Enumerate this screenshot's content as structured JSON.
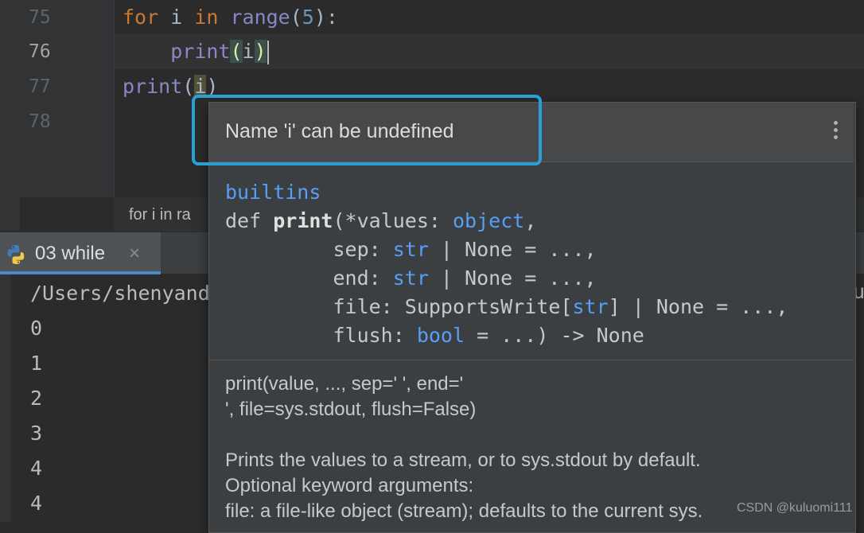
{
  "editor": {
    "line_numbers": [
      "75",
      "76",
      "77",
      "78"
    ],
    "lines": {
      "l75": {
        "kw_for": "for",
        "var": " i ",
        "kw_in": "in",
        "fn": " range",
        "open": "(",
        "num": "5",
        "close": "):"
      },
      "l76": {
        "indent": "    ",
        "fn": "print",
        "open": "(",
        "arg": "i",
        "close": ")"
      },
      "l77": {
        "fn": "print",
        "open": "(",
        "arg": "i",
        "close": ")"
      }
    },
    "breadcrumb": "for i in ra"
  },
  "run": {
    "tab_label": "03 while",
    "tab_close": "×",
    "output": [
      "/Users/shenyand",
      "0",
      "1",
      "2",
      "3",
      "4",
      "4"
    ],
    "edge_char": "u"
  },
  "popup": {
    "warning": "Name 'i' can be undefined",
    "module": "builtins",
    "signature": {
      "def": "def ",
      "name": "print",
      "l1_rest_a": "(*values: ",
      "l1_type": "object",
      "l1_rest_b": ",",
      "l2_a": "         sep: ",
      "l2_type": "str",
      "l2_b": " | None = ...,",
      "l3_a": "         end: ",
      "l3_type": "str",
      "l3_b": " | None = ...,",
      "l4_a": "         file: SupportsWrite[",
      "l4_type": "str",
      "l4_b": "] | None = ...,",
      "l5_a": "         flush: ",
      "l5_type": "bool",
      "l5_b": " = ...) -> None"
    },
    "doc": [
      "print(value, ..., sep=' ', end='",
      "', file=sys.stdout, flush=False)",
      "Prints the values to a stream, or to sys.stdout by default.",
      "Optional keyword arguments:",
      "file: a file-like object (stream); defaults to the current sys."
    ]
  },
  "watermark": "CSDN @kuluomi111",
  "colors": {
    "highlight_box": "#2a9fd6",
    "keyword": "#cc7832",
    "builtin": "#8888c6",
    "number": "#6897bb",
    "type": "#589df6"
  }
}
